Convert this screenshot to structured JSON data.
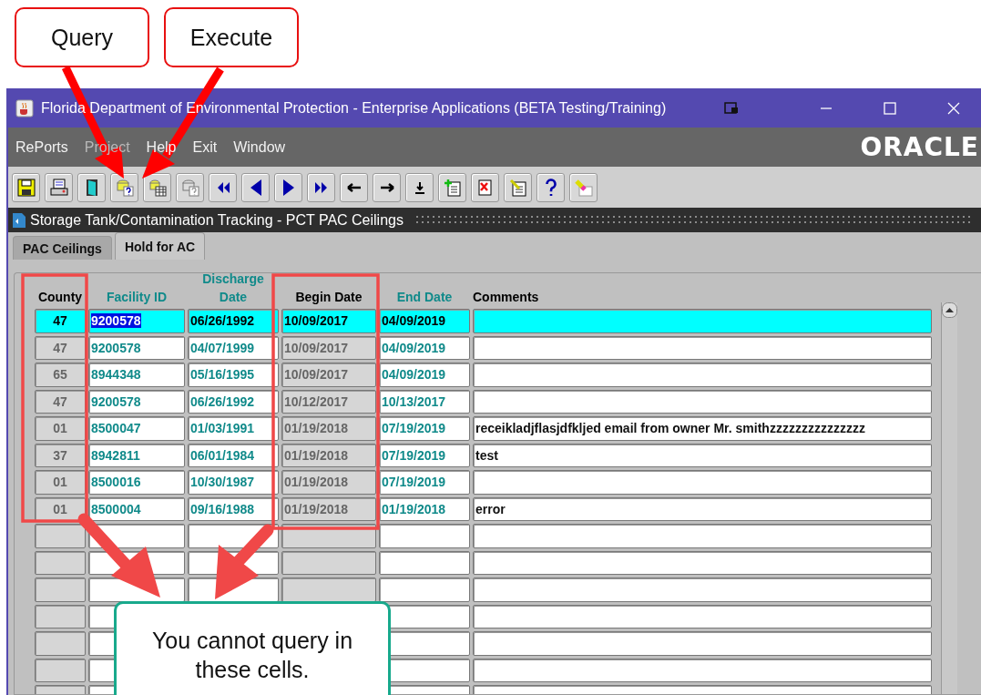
{
  "callouts": [
    {
      "text": "Query",
      "kind": "red"
    },
    {
      "text": "Execute",
      "kind": "red"
    },
    {
      "text": "You cannot query in these cells.",
      "kind": "green"
    }
  ],
  "window": {
    "title": "Florida Department of Environmental Protection - Enterprise Applications (BETA Testing/Training)",
    "logo": "ORACLE"
  },
  "menu": [
    {
      "label": "RePorts",
      "disabled": false
    },
    {
      "label": "Project",
      "disabled": true
    },
    {
      "label": "Help",
      "disabled": false
    },
    {
      "label": "Exit",
      "disabled": false
    },
    {
      "label": "Window",
      "disabled": false
    }
  ],
  "form_title": "Storage Tank/Contamination Tracking - PCT PAC Ceilings",
  "tabs": [
    {
      "label": "PAC Ceilings",
      "selected": false
    },
    {
      "label": "Hold for AC",
      "selected": true
    }
  ],
  "table": {
    "columns": [
      {
        "label": "County",
        "kind": "readonly",
        "color": "#000000"
      },
      {
        "label": "Facility ID",
        "kind": "field",
        "color": "#108a8a"
      },
      {
        "label": "Discharge Date",
        "kind": "field",
        "color": "#108a8a"
      },
      {
        "label": "Begin Date",
        "kind": "readonly",
        "color": "#000000"
      },
      {
        "label": "End Date",
        "kind": "field",
        "color": "#108a8a"
      },
      {
        "label": "Comments",
        "kind": "field",
        "color": "#000000"
      }
    ],
    "rows": [
      {
        "cells": [
          "47",
          "9200578",
          "06/26/1992",
          "10/09/2017",
          "04/09/2019",
          ""
        ],
        "selected": true,
        "text_highlighted": true
      },
      {
        "cells": [
          "47",
          "9200578",
          "04/07/1999",
          "10/09/2017",
          "04/09/2019",
          ""
        ],
        "selected": false,
        "text_highlighted": false
      },
      {
        "cells": [
          "65",
          "8944348",
          "05/16/1995",
          "10/09/2017",
          "04/09/2019",
          ""
        ],
        "selected": false,
        "text_highlighted": false
      },
      {
        "cells": [
          "47",
          "9200578",
          "06/26/1992",
          "10/12/2017",
          "10/13/2017",
          ""
        ],
        "selected": false,
        "text_highlighted": false
      },
      {
        "cells": [
          "01",
          "8500047",
          "01/03/1991",
          "01/19/2018",
          "07/19/2019",
          "receikladjflasjdfkljed email from owner Mr. smithzzzzzzzzzzzzzzz"
        ],
        "selected": false,
        "text_highlighted": false
      },
      {
        "cells": [
          "37",
          "8942811",
          "06/01/1984",
          "01/19/2018",
          "07/19/2019",
          "test"
        ],
        "selected": false,
        "text_highlighted": false
      },
      {
        "cells": [
          "01",
          "8500016",
          "10/30/1987",
          "01/19/2018",
          "07/19/2019",
          ""
        ],
        "selected": false,
        "text_highlighted": false
      },
      {
        "cells": [
          "01",
          "8500004",
          "09/16/1988",
          "01/19/2018",
          "01/19/2018",
          "error"
        ],
        "selected": false,
        "text_highlighted": false
      }
    ]
  }
}
